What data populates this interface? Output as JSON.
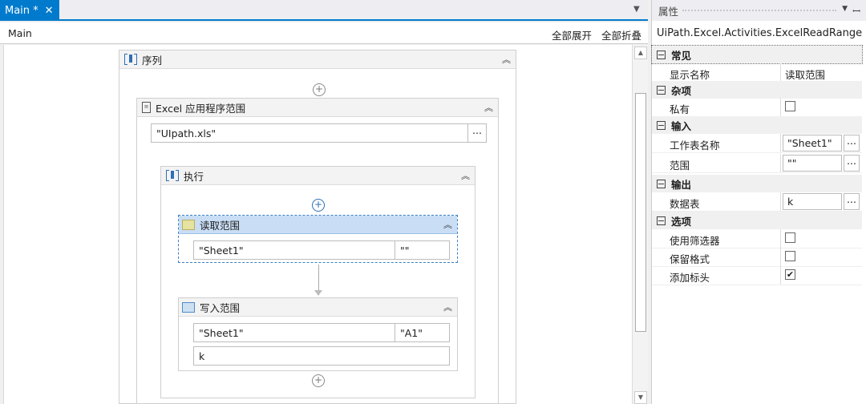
{
  "tab": {
    "label": "Main *",
    "close": "✕"
  },
  "breadcrumb": "Main",
  "toolbar": {
    "expand_all": "全部展开",
    "collapse_all": "全部折叠"
  },
  "designer": {
    "sequence": {
      "title": "序列"
    },
    "excel_scope": {
      "title": "Excel 应用程序范围",
      "path": "\"UIpath.xls\"",
      "browse": "..."
    },
    "execute": {
      "title": "执行"
    },
    "read_range": {
      "title": "读取范围",
      "sheet": "\"Sheet1\"",
      "range": "\"\""
    },
    "write_range": {
      "title": "写入范围",
      "sheet": "\"Sheet1\"",
      "range": "\"A1\"",
      "datatable": "k"
    }
  },
  "properties": {
    "panel_title": "属性",
    "class_name": "UiPath.Excel.Activities.ExcelReadRange",
    "categories": {
      "common": "常见",
      "misc": "杂项",
      "input": "输入",
      "output": "输出",
      "options": "选项"
    },
    "rows": {
      "display_name": {
        "name": "显示名称",
        "value": "读取范围"
      },
      "private": {
        "name": "私有",
        "checked": false
      },
      "sheet_name": {
        "name": "工作表名称",
        "value": "\"Sheet1\""
      },
      "range": {
        "name": "范围",
        "value": "\"\""
      },
      "datatable": {
        "name": "数据表",
        "value": "k"
      },
      "use_filter": {
        "name": "使用筛选器",
        "checked": false
      },
      "preserve_format": {
        "name": "保留格式",
        "checked": false
      },
      "add_headers": {
        "name": "添加标头",
        "checked": true
      }
    },
    "ellipsis": "..."
  },
  "colors": {
    "accent": "#007acc",
    "selected_activity": "#c9def5"
  }
}
